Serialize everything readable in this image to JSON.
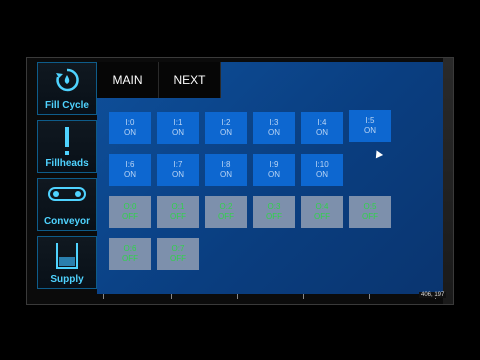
{
  "sidebar": {
    "items": [
      {
        "label": "Fill Cycle",
        "icon": "refresh-drop-icon"
      },
      {
        "label": "Fillheads",
        "icon": "exclamation-icon"
      },
      {
        "label": "Conveyor",
        "icon": "conveyor-belt-icon"
      },
      {
        "label": "Supply",
        "icon": "tank-icon"
      }
    ]
  },
  "topbar": {
    "main_label": "MAIN",
    "next_label": "NEXT"
  },
  "inputs": [
    {
      "id": "I:0",
      "state": "ON"
    },
    {
      "id": "I:1",
      "state": "ON"
    },
    {
      "id": "I:2",
      "state": "ON"
    },
    {
      "id": "I:3",
      "state": "ON"
    },
    {
      "id": "I:4",
      "state": "ON"
    },
    {
      "id": "I:5",
      "state": "ON"
    },
    {
      "id": "I:6",
      "state": "ON"
    },
    {
      "id": "I:7",
      "state": "ON"
    },
    {
      "id": "I:8",
      "state": "ON"
    },
    {
      "id": "I:9",
      "state": "ON"
    },
    {
      "id": "I:10",
      "state": "ON"
    }
  ],
  "outputs": [
    {
      "id": "O:0",
      "state": "OFF"
    },
    {
      "id": "O:1",
      "state": "OFF"
    },
    {
      "id": "O:2",
      "state": "OFF"
    },
    {
      "id": "O:3",
      "state": "OFF"
    },
    {
      "id": "O:4",
      "state": "OFF"
    },
    {
      "id": "O:5",
      "state": "OFF"
    },
    {
      "id": "O:6",
      "state": "OFF"
    },
    {
      "id": "O:7",
      "state": "OFF"
    }
  ],
  "status": {
    "coordinates": "406, 197"
  },
  "colors": {
    "panel_blue": "#0a3e80",
    "input_on": "#0d67d0",
    "output_off_bg": "#7d90ac",
    "output_off_text": "#2fd34a",
    "nav_text": "#4fd3ff"
  }
}
